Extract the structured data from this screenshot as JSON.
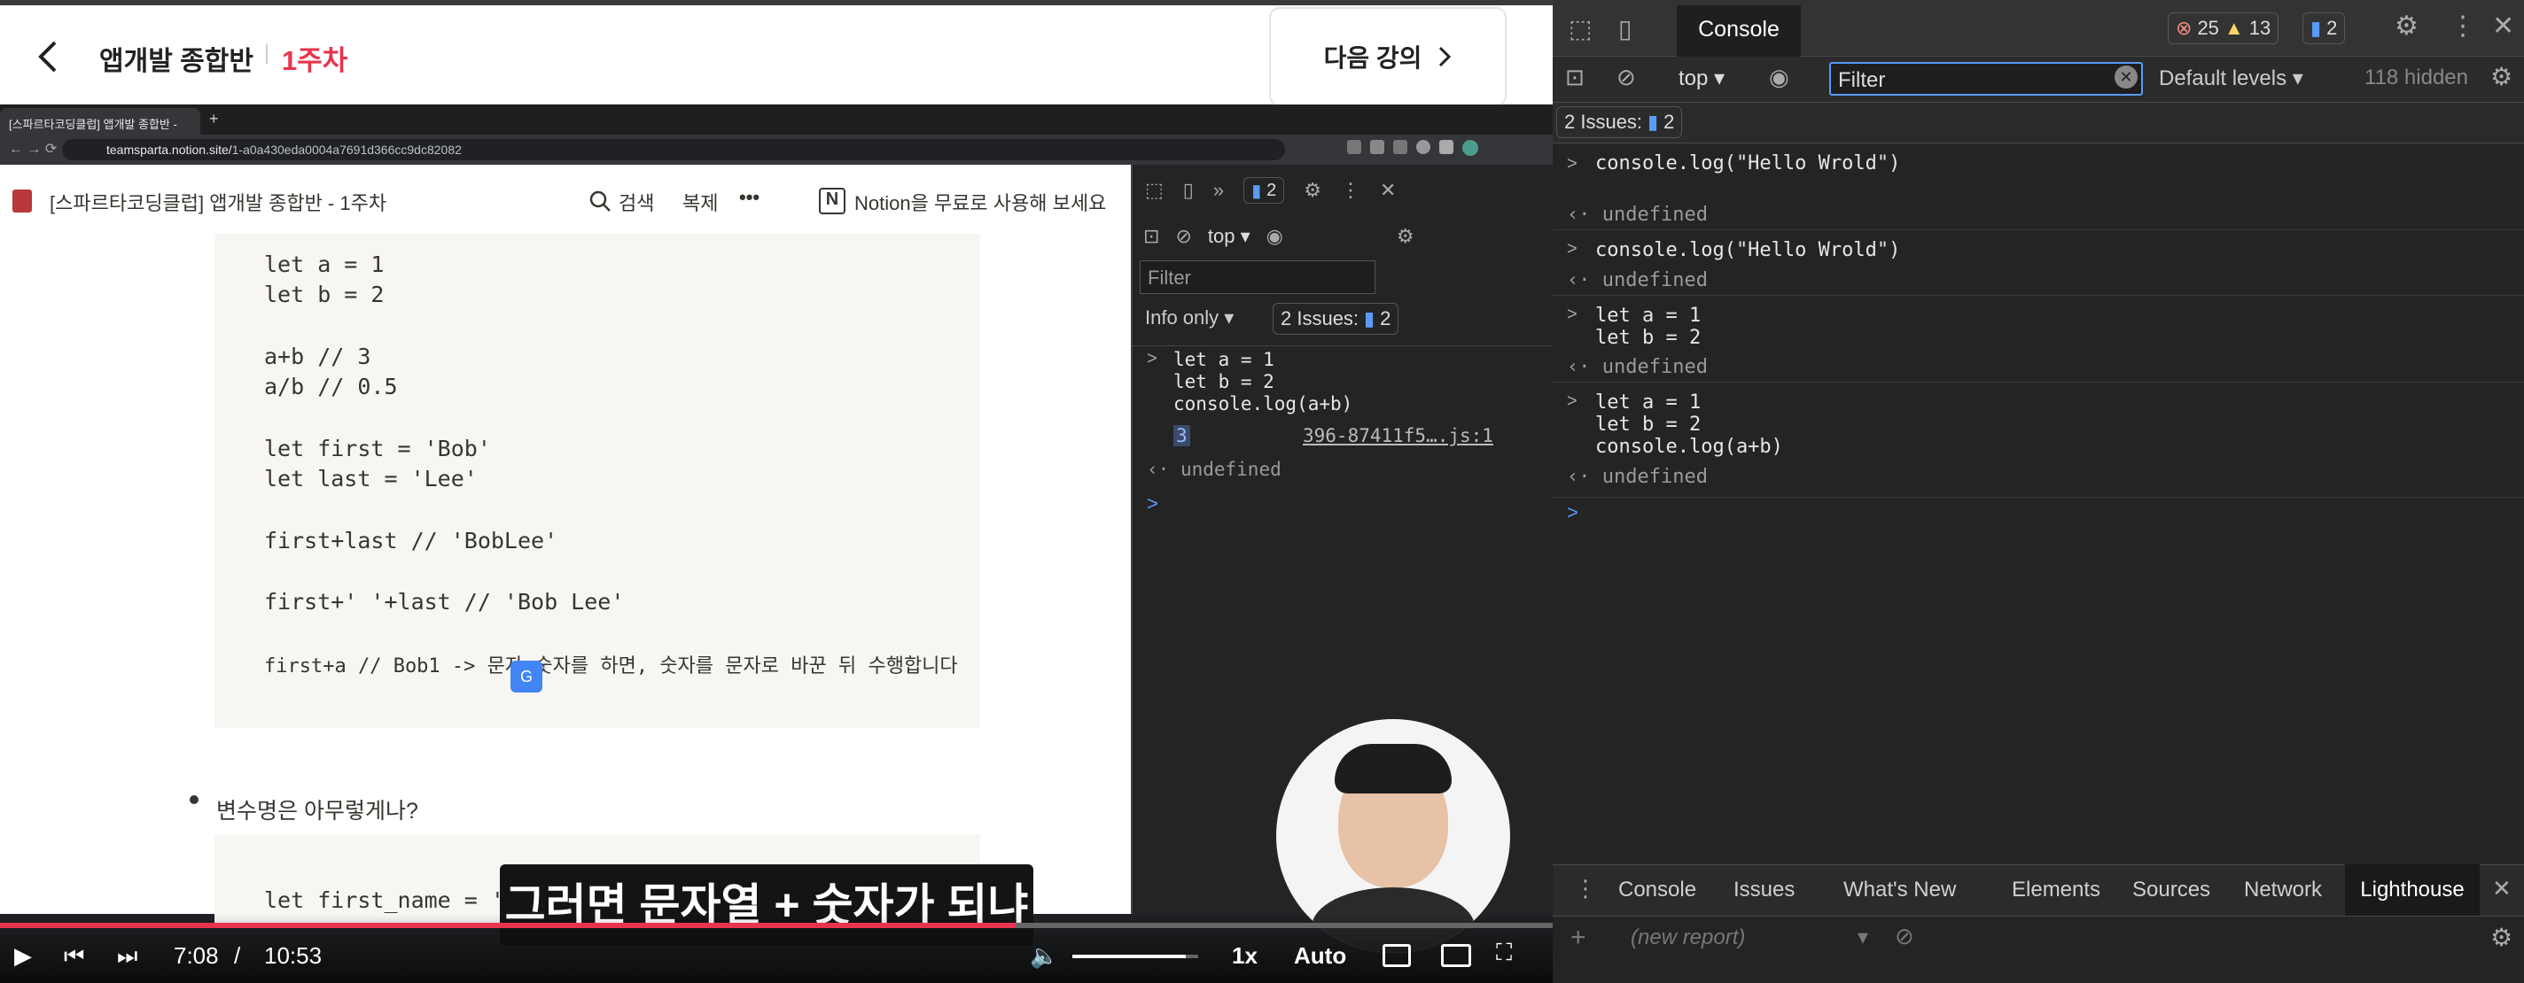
{
  "header": {
    "course": "앱개발 종합반",
    "week": "1주차",
    "next_label": "다음 강의"
  },
  "browser": {
    "tab_title": "[스파르타코딩클럽] 앱개발 종합반 - ",
    "url_host": "teamsparta.notion.site/",
    "url_path": "1-a0a430eda0004a7691d366cc9dc82082"
  },
  "notion": {
    "page_title": "[스파르타코딩클럽] 앱개발 종합반 - 1주차",
    "search_label": "검색",
    "duplicate_label": "복제",
    "more_label": "•••",
    "promo": "Notion을 무료로 사용해 보세요"
  },
  "code": {
    "l1": "let a = 1",
    "l2": "let b = 2",
    "l3": "a+b // 3",
    "l4": "a/b // 0.5",
    "l5": "let first = 'Bob'",
    "l6": "let last = 'Lee'",
    "l7": "first+last // 'BobLee'",
    "l8": "first+' '+last // 'Bob Lee'",
    "l9": "first+a // Bob1 -> 문자+숫자를 하면, 숫자를 문자로 바꾼 뒤 수행합니다",
    "bullet": "변수명은 아무렇게나?",
    "l10": "let first_name = 'bo"
  },
  "devtools_small": {
    "top": "top",
    "filter": "Filter",
    "info_only": "Info only",
    "issues": "2 Issues:",
    "issues_count": "2",
    "badge": "2",
    "input": "let a = 1\nlet b = 2\nconsole.log(a+b)",
    "result": "3",
    "source": "396-87411f5….js:1",
    "undefined": "undefined"
  },
  "devtools": {
    "tab_console": "Console",
    "errors": "25",
    "warnings": "13",
    "messages": "2",
    "context": "top",
    "filter": "Filter",
    "levels": "Default levels",
    "hidden": "118 hidden",
    "issues": "2 Issues:",
    "issues_count": "2",
    "entries": [
      {
        "input": "console.log(\"Hello Wrold\")",
        "output": "undefined"
      },
      {
        "input": "console.log(\"Hello Wrold\")",
        "output": "undefined"
      },
      {
        "input": "let a = 1\nlet b = 2",
        "output": "undefined"
      },
      {
        "input": "let a = 1\nlet b = 2\nconsole.log(a+b)",
        "output": "undefined"
      }
    ],
    "drawer_tabs": [
      "Console",
      "Issues",
      "What's New",
      "Elements",
      "Sources",
      "Network",
      "Lighthouse"
    ],
    "new_report": "(new report)"
  },
  "player": {
    "current": "7:08",
    "slash": "/",
    "duration": "10:53",
    "speed": "1x",
    "quality": "Auto",
    "progress": 0.654,
    "volume": 0.9
  },
  "subtitle": "그러면 문자열 + 숫자가 되냐",
  "colors": {
    "accent": "#e8344e",
    "devtools_bg": "#242424"
  }
}
